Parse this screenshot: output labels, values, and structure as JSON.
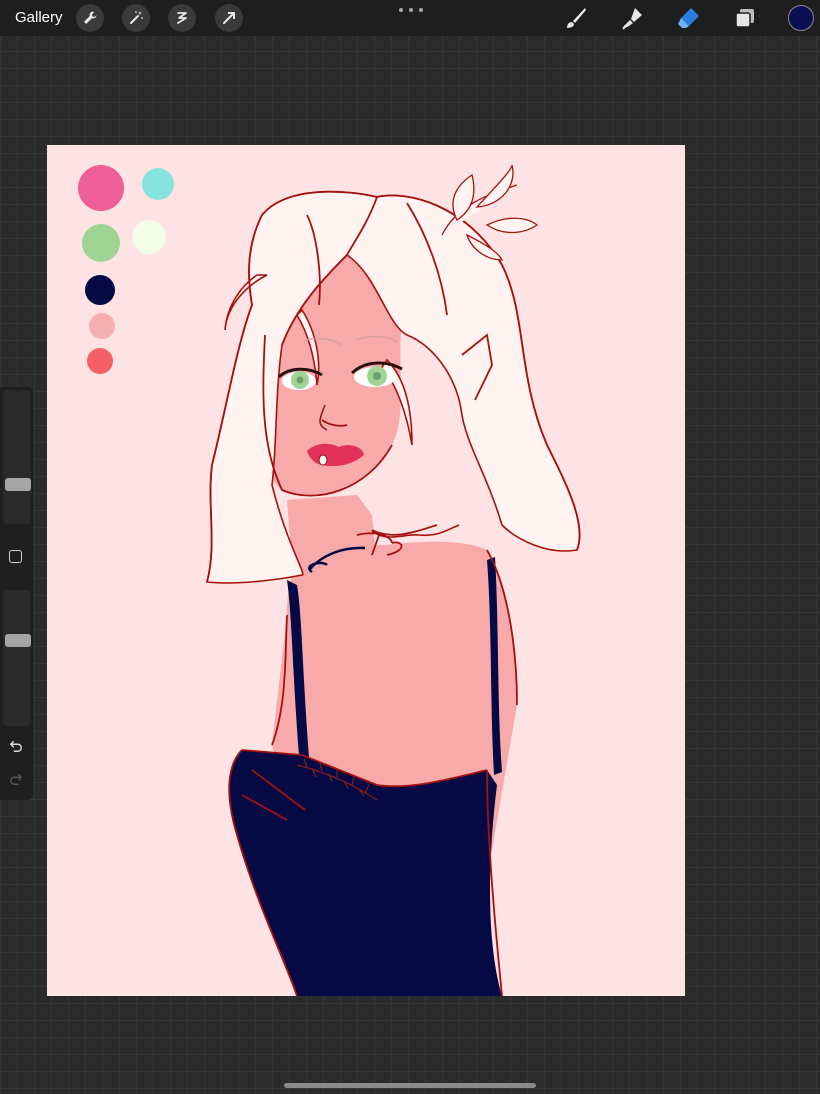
{
  "toolbar": {
    "gallery_label": "Gallery",
    "left_tools": [
      "wrench-icon",
      "magic-wand-icon",
      "selection-icon",
      "transform-arrow-icon"
    ],
    "more_icon": "more-dots-icon",
    "right_tools": [
      "brush-icon",
      "smudge-icon",
      "eraser-icon",
      "layers-icon"
    ],
    "active_tool": "eraser",
    "current_color": "#0a0f52"
  },
  "sidebar": {
    "brush_size_level": 0.27,
    "opacity_level": 0.64,
    "undo_icon": "undo-icon",
    "redo_icon": "redo-icon"
  },
  "canvas": {
    "background_color": "#fde3e3",
    "palette": [
      "#ee5f98",
      "#86e4de",
      "#9fd494",
      "#f3fde8",
      "#050a45",
      "#f7b0b1",
      "#f86067"
    ],
    "artwork_colors": {
      "skin": "#f8aaaa",
      "hair": "#fff4f2",
      "lineart": "#a5110f",
      "dress": "#050a45",
      "eyes": "#9fd494",
      "lips": "#e1305a"
    }
  }
}
